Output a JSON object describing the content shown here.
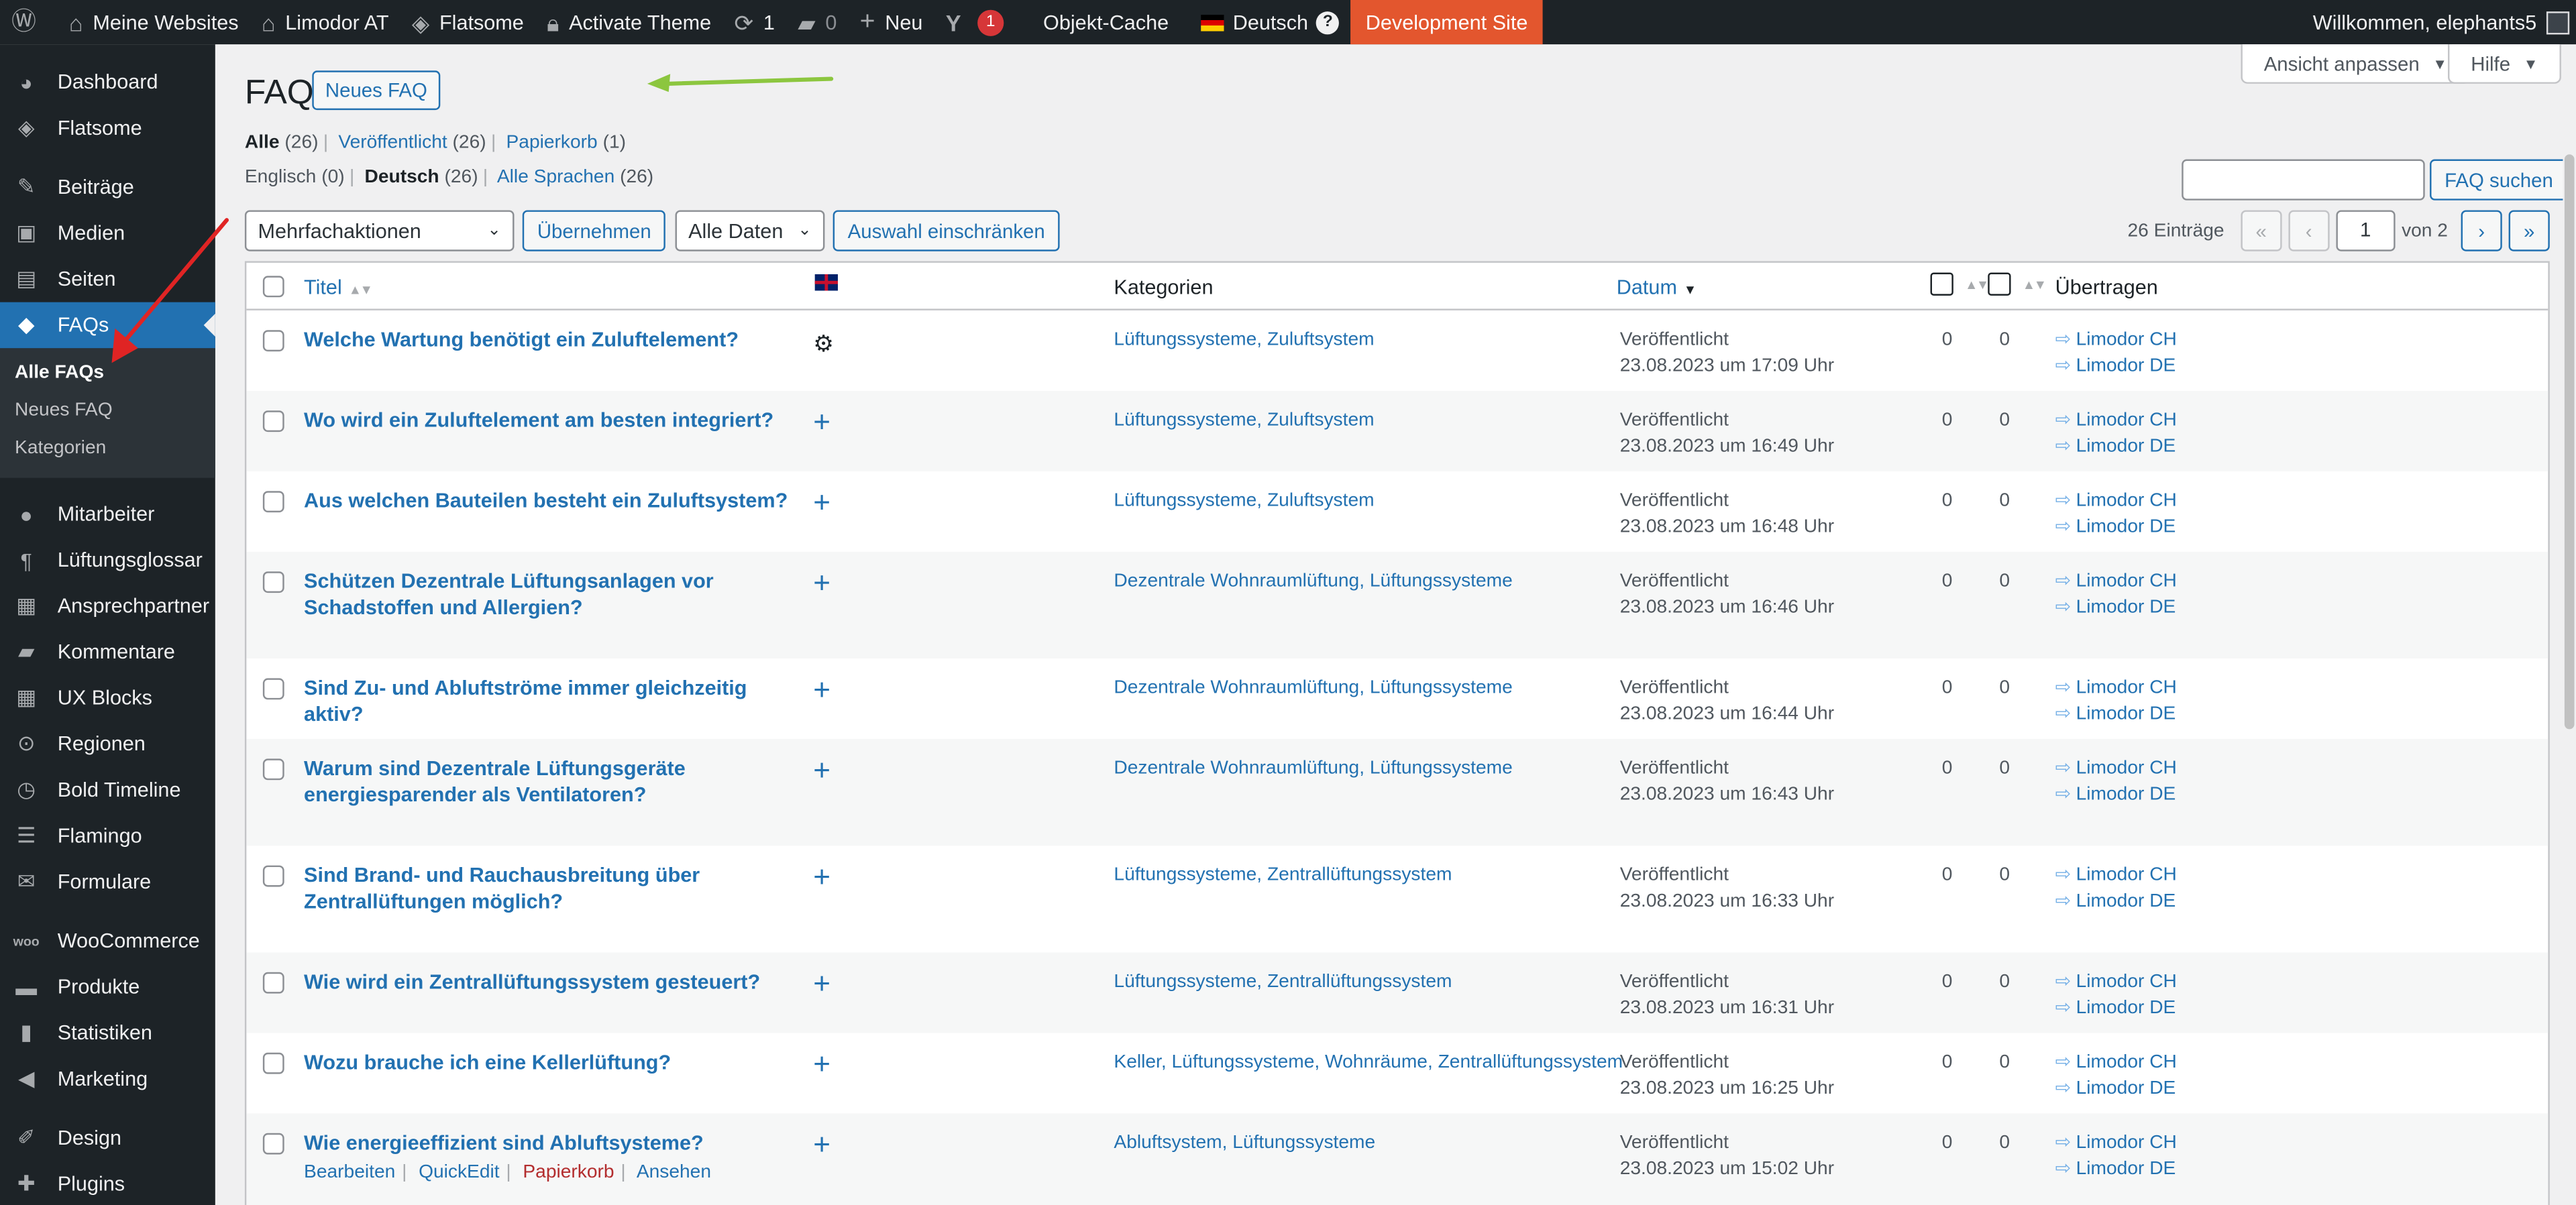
{
  "adminbar": {
    "sites": "Meine Websites",
    "site_name": "Limodor AT",
    "theme": "Flatsome",
    "activate_theme": "Activate Theme",
    "updates": "1",
    "comments": "0",
    "new": "Neu",
    "yoast_badge": "1",
    "cache": "Objekt-Cache",
    "language": "Deutsch",
    "help_mark": "?",
    "dev_site": "Development Site",
    "welcome": "Willkommen, elephants5"
  },
  "sidebar": {
    "items": [
      {
        "label": "Dashboard",
        "icon": "dashboard-icon"
      },
      {
        "label": "Flatsome",
        "icon": "flatsome-icon"
      },
      {
        "label": "Beiträge",
        "icon": "pin-icon"
      },
      {
        "label": "Medien",
        "icon": "media-icon"
      },
      {
        "label": "Seiten",
        "icon": "pages-icon"
      },
      {
        "label": "FAQs",
        "icon": "faq-icon"
      },
      {
        "label": "Mitarbeiter",
        "icon": "user-icon"
      },
      {
        "label": "Lüftungsglossar",
        "icon": "paragraph-icon"
      },
      {
        "label": "Ansprechpartner",
        "icon": "id-card-icon"
      },
      {
        "label": "Kommentare",
        "icon": "comment-icon"
      },
      {
        "label": "UX Blocks",
        "icon": "grid-icon"
      },
      {
        "label": "Regionen",
        "icon": "location-icon"
      },
      {
        "label": "Bold Timeline",
        "icon": "clock-icon"
      },
      {
        "label": "Flamingo",
        "icon": "list-icon"
      },
      {
        "label": "Formulare",
        "icon": "mail-icon"
      },
      {
        "label": "WooCommerce",
        "icon": "woo-icon"
      },
      {
        "label": "Produkte",
        "icon": "archive-icon"
      },
      {
        "label": "Statistiken",
        "icon": "chart-icon"
      },
      {
        "label": "Marketing",
        "icon": "megaphone-icon"
      },
      {
        "label": "Design",
        "icon": "brush-icon"
      },
      {
        "label": "Plugins",
        "icon": "plugin-icon"
      }
    ],
    "submenu": [
      "Alle FAQs",
      "Neues FAQ",
      "Kategorien"
    ]
  },
  "screen": {
    "options": "Ansicht anpassen",
    "help": "Hilfe"
  },
  "page": {
    "title": "FAQ",
    "new_button": "Neues FAQ"
  },
  "filters": {
    "all": "Alle",
    "all_count": "(26)",
    "published": "Veröffentlicht",
    "published_count": "(26)",
    "trash": "Papierkorb",
    "trash_count": "(1)",
    "lang_en": "Englisch",
    "lang_en_count": "(0)",
    "lang_de": "Deutsch",
    "lang_de_count": "(26)",
    "lang_all": "Alle Sprachen",
    "lang_all_count": "(26)"
  },
  "search": {
    "button": "FAQ suchen",
    "value": ""
  },
  "bulk": {
    "select": "Mehrfachaktionen",
    "apply": "Übernehmen",
    "dates": "Alle Daten",
    "filter": "Auswahl einschränken"
  },
  "pagination": {
    "count": "26 Einträge",
    "first": "«",
    "prev": "‹",
    "page": "1",
    "of": "von 2",
    "next": "›",
    "last": "»"
  },
  "table": {
    "headers": {
      "title": "Titel",
      "categories": "Kategorien",
      "date": "Datum",
      "translate": "Übertragen"
    },
    "row_actions": {
      "edit": "Bearbeiten",
      "quickedit": "QuickEdit",
      "trash": "Papierkorb",
      "view": "Ansehen"
    },
    "rows": [
      {
        "title": "Welche Wartung benötigt ein Zuluftelement?",
        "categories": "Lüftungssysteme, Zuluftsystem",
        "status": "Veröffentlicht",
        "date": "23.08.2023 um 17:09 Uhr",
        "c1": "0",
        "c2": "0",
        "t1": "Limodor CH",
        "t2": "Limodor DE"
      },
      {
        "title": "Wo wird ein Zuluftelement am besten integriert?",
        "categories": "Lüftungssysteme, Zuluftsystem",
        "status": "Veröffentlicht",
        "date": "23.08.2023 um 16:49 Uhr",
        "c1": "0",
        "c2": "0",
        "t1": "Limodor CH",
        "t2": "Limodor DE"
      },
      {
        "title": "Aus welchen Bauteilen besteht ein Zuluftsystem?",
        "categories": "Lüftungssysteme, Zuluftsystem",
        "status": "Veröffentlicht",
        "date": "23.08.2023 um 16:48 Uhr",
        "c1": "0",
        "c2": "0",
        "t1": "Limodor CH",
        "t2": "Limodor DE"
      },
      {
        "title": "Schützen Dezentrale Lüftungsanlagen vor Schadstoffen und Allergien?",
        "categories": "Dezentrale Wohnraumlüftung, Lüftungssysteme",
        "status": "Veröffentlicht",
        "date": "23.08.2023 um 16:46 Uhr",
        "c1": "0",
        "c2": "0",
        "t1": "Limodor CH",
        "t2": "Limodor DE"
      },
      {
        "title": "Sind Zu- und Abluftströme immer gleichzeitig aktiv?",
        "categories": "Dezentrale Wohnraumlüftung, Lüftungssysteme",
        "status": "Veröffentlicht",
        "date": "23.08.2023 um 16:44 Uhr",
        "c1": "0",
        "c2": "0",
        "t1": "Limodor CH",
        "t2": "Limodor DE"
      },
      {
        "title": "Warum sind Dezentrale Lüftungsgeräte energiesparender als Ventilatoren?",
        "categories": "Dezentrale Wohnraumlüftung, Lüftungssysteme",
        "status": "Veröffentlicht",
        "date": "23.08.2023 um 16:43 Uhr",
        "c1": "0",
        "c2": "0",
        "t1": "Limodor CH",
        "t2": "Limodor DE"
      },
      {
        "title": "Sind Brand- und Rauchausbreitung über Zentrallüftungen möglich?",
        "categories": "Lüftungssysteme, Zentrallüftungssystem",
        "status": "Veröffentlicht",
        "date": "23.08.2023 um 16:33 Uhr",
        "c1": "0",
        "c2": "0",
        "t1": "Limodor CH",
        "t2": "Limodor DE"
      },
      {
        "title": "Wie wird ein Zentrallüftungssystem gesteuert?",
        "categories": "Lüftungssysteme, Zentrallüftungssystem",
        "status": "Veröffentlicht",
        "date": "23.08.2023 um 16:31 Uhr",
        "c1": "0",
        "c2": "0",
        "t1": "Limodor CH",
        "t2": "Limodor DE"
      },
      {
        "title": "Wozu brauche ich eine Kellerlüftung?",
        "categories": "Keller, Lüftungssysteme, Wohnräume, Zentrallüftungssystem",
        "status": "Veröffentlicht",
        "date": "23.08.2023 um 16:25 Uhr",
        "c1": "0",
        "c2": "0",
        "t1": "Limodor CH",
        "t2": "Limodor DE"
      },
      {
        "title": "Wie energieeffizient sind Abluftsysteme?",
        "categories": "Abluftsystem, Lüftungssysteme",
        "status": "Veröffentlicht",
        "date": "23.08.2023 um 15:02 Uhr",
        "c1": "0",
        "c2": "0",
        "t1": "Limodor CH",
        "t2": "Limodor DE"
      }
    ]
  },
  "colors": {
    "accent": "#2271b1",
    "adminbar": "#1d2327",
    "dev": "#e3562e",
    "arrow_red": "#e02424",
    "arrow_green": "#8cc63f"
  }
}
